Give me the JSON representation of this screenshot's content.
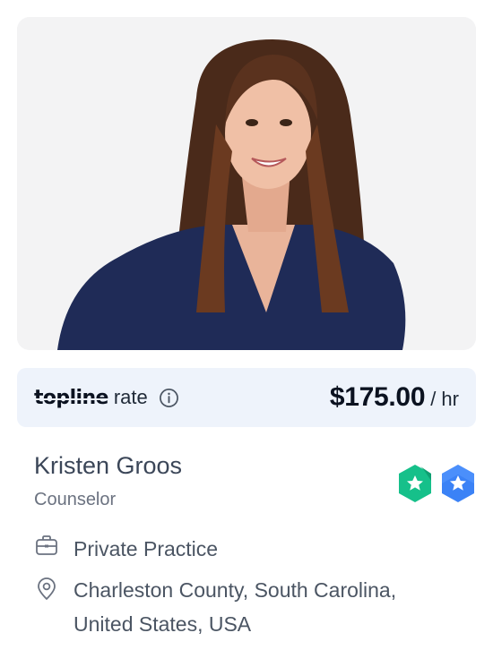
{
  "profile": {
    "name": "Kristen Groos",
    "role": "Counselor",
    "practice": "Private Practice",
    "location": "Charleston County, South Carolina, United States, USA"
  },
  "rate": {
    "brand": "topline",
    "label": "rate",
    "price": "$175.00",
    "unit": "/ hr"
  },
  "badges": [
    {
      "icon": "green-hexagon-star-badge-icon",
      "color": "#16c08a"
    },
    {
      "icon": "blue-hexagon-star-badge-icon",
      "color": "#3b82f6"
    }
  ],
  "icons": {
    "info": "info-circle-icon",
    "practice": "briefcase-icon",
    "location": "map-pin-icon"
  },
  "colors": {
    "rate_bg": "#eef3fb",
    "text_primary": "#0b1220",
    "text_secondary": "#6b7280"
  }
}
